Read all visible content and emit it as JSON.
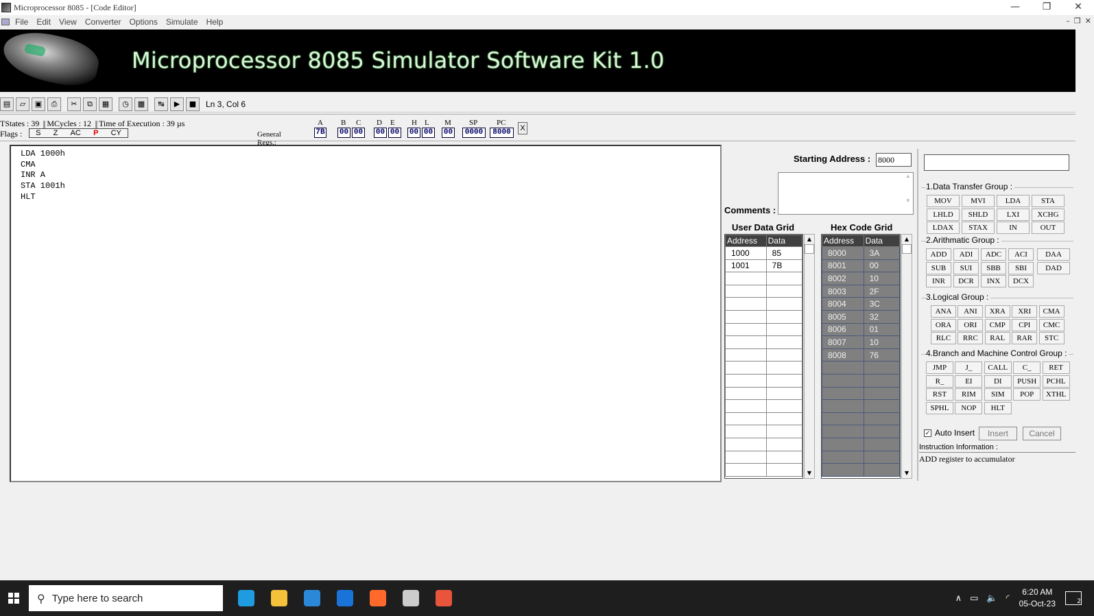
{
  "window": {
    "title": "Microprocessor 8085 - [Code Editor]",
    "controls": [
      "—",
      "❐",
      "✕"
    ]
  },
  "menu": {
    "items": [
      "File",
      "Edit",
      "View",
      "Converter",
      "Options",
      "Simulate",
      "Help"
    ],
    "mdi_controls": [
      "–",
      "❐",
      "✕"
    ]
  },
  "banner": {
    "title": "Microprocessor 8085 Simulator Software Kit 1.0"
  },
  "toolbar": {
    "status": "Ln 3, Col 6"
  },
  "info": {
    "tstates": "TStates : 39",
    "mcycles": "MCycles : 12",
    "time": "Time of Execution : 39 µs",
    "flags_label": "Flags :",
    "flags": [
      {
        "name": "S",
        "set": false
      },
      {
        "name": "Z",
        "set": false
      },
      {
        "name": "AC",
        "set": false
      },
      {
        "name": "P",
        "set": true
      },
      {
        "name": "CY",
        "set": false
      }
    ],
    "genregs_label": "General Regs.:",
    "registers": [
      {
        "name": "A",
        "value": "7B"
      },
      {
        "name": "B",
        "value": "00"
      },
      {
        "name": "C",
        "value": "00"
      },
      {
        "name": "D",
        "value": "00"
      },
      {
        "name": "E",
        "value": "00"
      },
      {
        "name": "H",
        "value": "00"
      },
      {
        "name": "L",
        "value": "00"
      },
      {
        "name": "M",
        "value": "00"
      },
      {
        "name": "SP",
        "value": "0000"
      },
      {
        "name": "PC",
        "value": "8000"
      }
    ],
    "close": "X"
  },
  "editor": {
    "code": "LDA 1000h\nCMA\nINR A\nSTA 1001h\nHLT"
  },
  "memory": {
    "starting_address_label": "Starting Address :",
    "starting_address": "8000",
    "comments_label": "Comments :",
    "user_grid_title": "User Data Grid",
    "hex_grid_title": "Hex Code Grid",
    "col_address": "Address",
    "col_data": "Data",
    "user_rows": [
      {
        "address": "1000",
        "data": "85"
      },
      {
        "address": "1001",
        "data": "7B"
      },
      {
        "address": "",
        "data": ""
      },
      {
        "address": "",
        "data": ""
      },
      {
        "address": "",
        "data": ""
      },
      {
        "address": "",
        "data": ""
      },
      {
        "address": "",
        "data": ""
      },
      {
        "address": "",
        "data": ""
      },
      {
        "address": "",
        "data": ""
      },
      {
        "address": "",
        "data": ""
      },
      {
        "address": "",
        "data": ""
      },
      {
        "address": "",
        "data": ""
      },
      {
        "address": "",
        "data": ""
      },
      {
        "address": "",
        "data": ""
      },
      {
        "address": "",
        "data": ""
      },
      {
        "address": "",
        "data": ""
      },
      {
        "address": "",
        "data": ""
      },
      {
        "address": "",
        "data": ""
      }
    ],
    "hex_rows": [
      {
        "address": "8000",
        "data": "3A"
      },
      {
        "address": "8001",
        "data": "00"
      },
      {
        "address": "8002",
        "data": "10"
      },
      {
        "address": "8003",
        "data": "2F"
      },
      {
        "address": "8004",
        "data": "3C"
      },
      {
        "address": "8005",
        "data": "32"
      },
      {
        "address": "8006",
        "data": "01"
      },
      {
        "address": "8007",
        "data": "10"
      },
      {
        "address": "8008",
        "data": "76"
      },
      {
        "address": "",
        "data": ""
      },
      {
        "address": "",
        "data": ""
      },
      {
        "address": "",
        "data": ""
      },
      {
        "address": "",
        "data": ""
      },
      {
        "address": "",
        "data": ""
      },
      {
        "address": "",
        "data": ""
      },
      {
        "address": "",
        "data": ""
      },
      {
        "address": "",
        "data": ""
      },
      {
        "address": "",
        "data": ""
      }
    ]
  },
  "instructions": {
    "groups": [
      {
        "label": "1.Data Transfer Group :",
        "buttons": [
          "MOV",
          "MVI",
          "LDA",
          "STA",
          "LHLD",
          "SHLD",
          "LXI",
          "XCHG",
          "LDAX",
          "STAX",
          "IN",
          "OUT"
        ]
      },
      {
        "label": "2.Arithmatic Group :",
        "buttons": [
          "ADD",
          "ADI",
          "ADC",
          "ACI",
          "SUB",
          "SUI",
          "SBB",
          "SBI",
          "INR",
          "DCR",
          "INX",
          "DCX"
        ],
        "side": [
          "DAA",
          "DAD"
        ]
      },
      {
        "label": "3.Logical Group :",
        "buttons": [
          "ANA",
          "ANI",
          "XRA",
          "XRI",
          "CMA",
          "ORA",
          "ORI",
          "CMP",
          "CPI",
          "CMC",
          "RLC",
          "RRC",
          "RAL",
          "RAR",
          "STC"
        ]
      },
      {
        "label": "4.Branch and Machine Control Group :",
        "buttons": [
          "JMP",
          "J_",
          "CALL",
          "C_",
          "RET",
          "R_",
          "EI",
          "DI",
          "PUSH",
          "PCHL",
          "RST",
          "RIM",
          "SIM",
          "POP",
          "XTHL",
          "SPHL",
          "NOP",
          "HLT"
        ]
      }
    ],
    "auto_insert": "Auto Insert",
    "insert": "Insert",
    "cancel": "Cancel",
    "info_label": "Instruction Information :",
    "info_text": "ADD register to accumulator"
  },
  "taskbar": {
    "search_placeholder": "Type here to search",
    "time": "6:20 AM",
    "date": "05-Oct-23",
    "notifications": "2",
    "apps": [
      {
        "name": "edge-icon",
        "color": "#1f9be0"
      },
      {
        "name": "file-explorer-icon",
        "color": "#f3c13a"
      },
      {
        "name": "store-icon",
        "color": "#2b88d8"
      },
      {
        "name": "mail-icon",
        "color": "#1a73d9"
      },
      {
        "name": "firefox-icon",
        "color": "#ff6a2c"
      },
      {
        "name": "simulator-icon",
        "color": "#cccccc"
      },
      {
        "name": "snip-tool-icon",
        "color": "#e8553c"
      }
    ]
  }
}
